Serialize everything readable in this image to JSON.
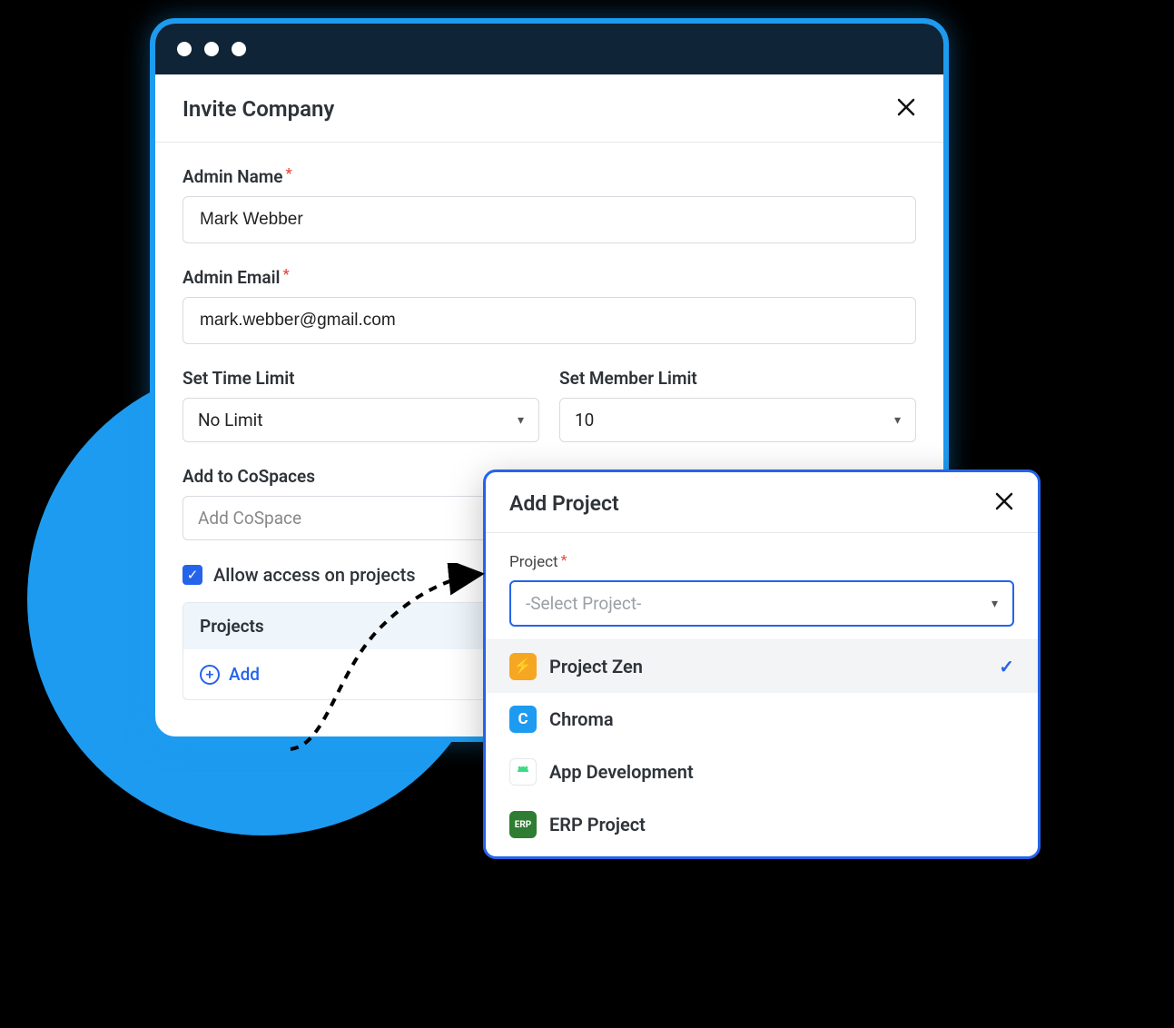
{
  "modal": {
    "title": "Invite Company",
    "admin_name_label": "Admin Name",
    "admin_name_value": "Mark Webber",
    "admin_email_label": "Admin Email",
    "admin_email_value": "mark.webber@gmail.com",
    "time_limit_label": "Set Time Limit",
    "time_limit_value": "No Limit",
    "member_limit_label": "Set Member Limit",
    "member_limit_value": "10",
    "cospaces_label": "Add to CoSpaces",
    "cospaces_placeholder": "Add CoSpace",
    "allow_access_label": "Allow access on projects",
    "projects_header": "Projects",
    "add_label": "Add"
  },
  "popup": {
    "title": "Add Project",
    "project_label": "Project",
    "select_placeholder": "-Select Project-",
    "options": [
      {
        "name": "Project Zen",
        "selected": true
      },
      {
        "name": "Chroma",
        "selected": false
      },
      {
        "name": "App Development",
        "selected": false
      },
      {
        "name": "ERP Project",
        "selected": false
      }
    ]
  }
}
